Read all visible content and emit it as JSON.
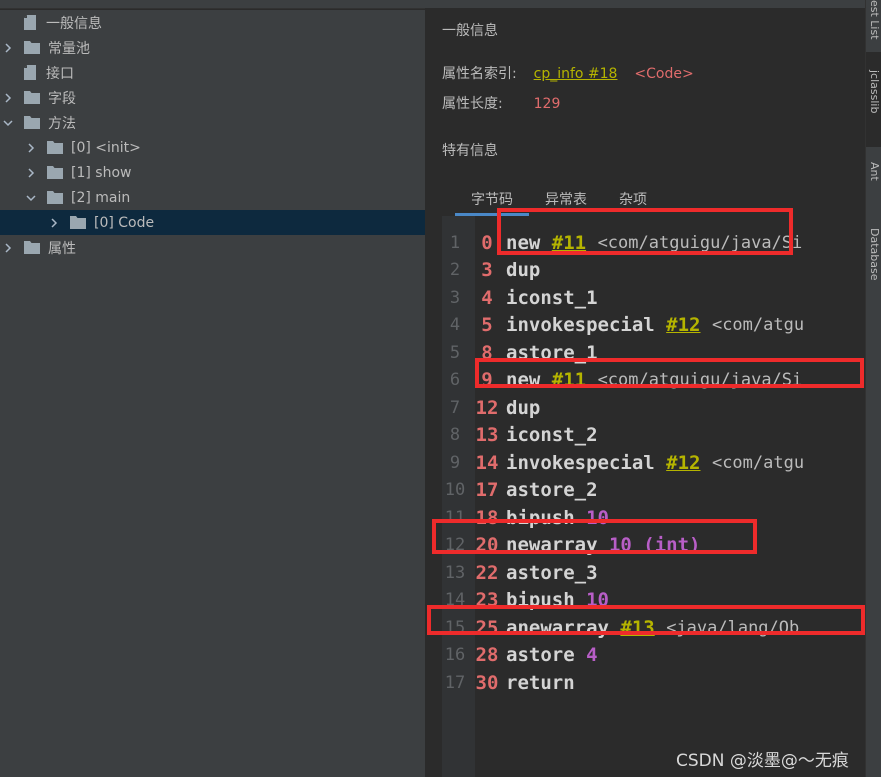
{
  "tree": {
    "items": [
      {
        "label": "一般信息",
        "icon": "file-icon",
        "expand": "none",
        "indent": 0
      },
      {
        "label": "常量池",
        "icon": "folder-icon",
        "expand": "collapsed",
        "indent": 0
      },
      {
        "label": "接口",
        "icon": "file-icon",
        "expand": "none",
        "indent": 0
      },
      {
        "label": "字段",
        "icon": "folder-icon",
        "expand": "collapsed",
        "indent": 0
      },
      {
        "label": "方法",
        "icon": "folder-icon",
        "expand": "expanded",
        "indent": 0
      },
      {
        "label": "[0] <init>",
        "icon": "folder-icon",
        "expand": "collapsed",
        "indent": 1
      },
      {
        "label": "[1] show",
        "icon": "folder-icon",
        "expand": "collapsed",
        "indent": 1
      },
      {
        "label": "[2] main",
        "icon": "folder-icon",
        "expand": "expanded",
        "indent": 1
      },
      {
        "label": "[0] Code",
        "icon": "folder-icon",
        "expand": "collapsed",
        "indent": 2,
        "selected": true
      },
      {
        "label": "属性",
        "icon": "folder-icon",
        "expand": "collapsed",
        "indent": 0
      }
    ]
  },
  "general": {
    "title": "一般信息",
    "attr_name_index_label": "属性名索引:",
    "attr_name_index_link": "cp_info #18",
    "attr_name_index_tag": "<Code>",
    "attr_length_label": "属性长度:",
    "attr_length_value": "129"
  },
  "specific": {
    "title": "特有信息",
    "tabs": [
      "字节码",
      "异常表",
      "杂项"
    ],
    "active_tab": 0
  },
  "bytecode": [
    {
      "ln": "1",
      "off": "0",
      "op": "new",
      "ref": "#11",
      "rest": "<com/atguigu/java/Si",
      "imm": ""
    },
    {
      "ln": "2",
      "off": "3",
      "op": "dup",
      "ref": "",
      "rest": "",
      "imm": ""
    },
    {
      "ln": "3",
      "off": "4",
      "op": "iconst_1",
      "ref": "",
      "rest": "",
      "imm": ""
    },
    {
      "ln": "4",
      "off": "5",
      "op": "invokespecial",
      "ref": "#12",
      "rest": "<com/atgu",
      "imm": ""
    },
    {
      "ln": "5",
      "off": "8",
      "op": "astore_1",
      "ref": "",
      "rest": "",
      "imm": ""
    },
    {
      "ln": "6",
      "off": "9",
      "op": "new",
      "ref": "#11",
      "rest": "<com/atguigu/java/Si",
      "imm": ""
    },
    {
      "ln": "7",
      "off": "12",
      "op": "dup",
      "ref": "",
      "rest": "",
      "imm": ""
    },
    {
      "ln": "8",
      "off": "13",
      "op": "iconst_2",
      "ref": "",
      "rest": "",
      "imm": ""
    },
    {
      "ln": "9",
      "off": "14",
      "op": "invokespecial",
      "ref": "#12",
      "rest": "<com/atgu",
      "imm": ""
    },
    {
      "ln": "10",
      "off": "17",
      "op": "astore_2",
      "ref": "",
      "rest": "",
      "imm": ""
    },
    {
      "ln": "11",
      "off": "18",
      "op": "bipush",
      "ref": "",
      "rest": "",
      "imm": "10"
    },
    {
      "ln": "12",
      "off": "20",
      "op": "newarray",
      "ref": "",
      "rest": "",
      "imm": "10 (int)"
    },
    {
      "ln": "13",
      "off": "22",
      "op": "astore_3",
      "ref": "",
      "rest": "",
      "imm": ""
    },
    {
      "ln": "14",
      "off": "23",
      "op": "bipush",
      "ref": "",
      "rest": "",
      "imm": "10"
    },
    {
      "ln": "15",
      "off": "25",
      "op": "anewarray",
      "ref": "#13",
      "rest": "<java/lang/Ob",
      "imm": ""
    },
    {
      "ln": "16",
      "off": "28",
      "op": "astore",
      "ref": "",
      "rest": "",
      "imm": "4"
    },
    {
      "ln": "17",
      "off": "30",
      "op": "return",
      "ref": "",
      "rest": "",
      "imm": ""
    }
  ],
  "sidebar_tools": [
    "est List",
    "jclasslib",
    "Ant",
    "Database"
  ],
  "watermark": "CSDN @淡墨@～无痕",
  "colors": {
    "highlight_box": "#ee2b2b",
    "offset": "#e06c6c",
    "ref": "#b5b400",
    "immediate": "#b85ec7"
  }
}
